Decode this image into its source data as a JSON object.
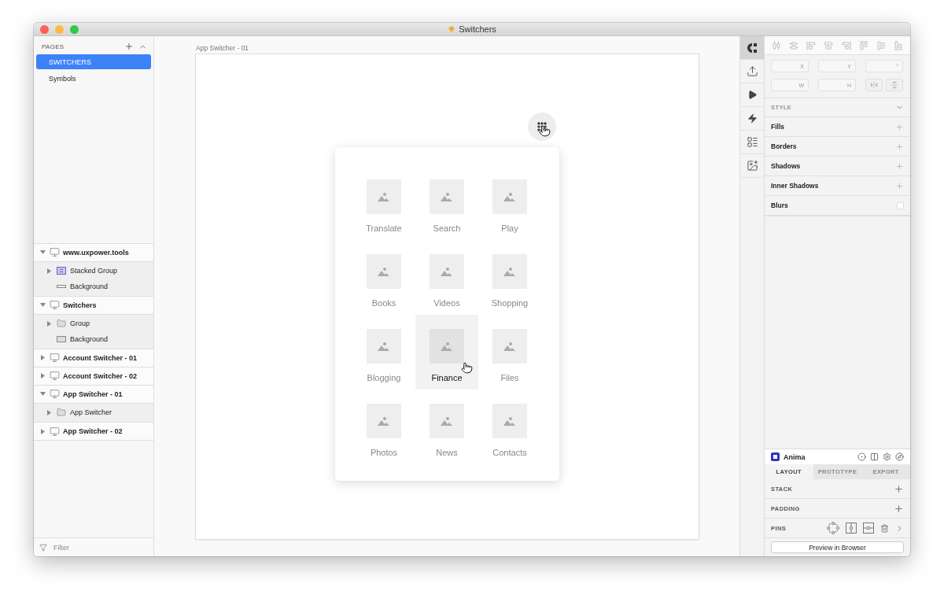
{
  "window": {
    "title": "Switchers"
  },
  "pages": {
    "header": "PAGES",
    "items": [
      {
        "label": "SWITCHERS",
        "selected": true
      },
      {
        "label": "Symbols",
        "selected": false
      }
    ]
  },
  "layers": [
    {
      "name": "www.uxpower.tools",
      "expanded": true,
      "children": [
        {
          "name": "Stacked Group",
          "kind": "stack",
          "expanded": false
        },
        {
          "name": "Background",
          "kind": "line"
        }
      ]
    },
    {
      "name": "Switchers",
      "expanded": true,
      "children": [
        {
          "name": "Group",
          "kind": "group",
          "expanded": false
        },
        {
          "name": "Background",
          "kind": "rectangle"
        }
      ]
    },
    {
      "name": "Account Switcher - 01",
      "expanded": false
    },
    {
      "name": "Account Switcher - 02",
      "expanded": false
    },
    {
      "name": "App Switcher - 01",
      "expanded": true,
      "children": [
        {
          "name": "App Switcher",
          "kind": "group",
          "expanded": false
        }
      ]
    },
    {
      "name": "App Switcher - 02",
      "expanded": false
    }
  ],
  "filter": {
    "placeholder": "Filter"
  },
  "canvas": {
    "artboard_title": "App Switcher - 01",
    "apps": [
      {
        "label": "Translate",
        "selected": false
      },
      {
        "label": "Search",
        "selected": false
      },
      {
        "label": "Play",
        "selected": false
      },
      {
        "label": "Books",
        "selected": false
      },
      {
        "label": "Videos",
        "selected": false
      },
      {
        "label": "Shopping",
        "selected": false
      },
      {
        "label": "Blogging",
        "selected": false
      },
      {
        "label": "Finance",
        "selected": true
      },
      {
        "label": "Files",
        "selected": false
      },
      {
        "label": "Photos",
        "selected": false
      },
      {
        "label": "News",
        "selected": false
      },
      {
        "label": "Contacts",
        "selected": false
      }
    ]
  },
  "inspector_tabs": [
    {
      "kind": "craft",
      "selected": true
    },
    {
      "kind": "export",
      "selected": false
    },
    {
      "kind": "preview",
      "selected": false
    },
    {
      "kind": "prototype",
      "selected": false
    },
    {
      "kind": "layout",
      "selected": false
    },
    {
      "kind": "image",
      "selected": false
    }
  ],
  "fields": [
    {
      "label": "X"
    },
    {
      "label": "Y"
    },
    {
      "label": "°"
    },
    {
      "label": "W"
    },
    {
      "label": "H"
    }
  ],
  "style": {
    "header": "STYLE",
    "sections": [
      {
        "label": "Fills",
        "kind": "add"
      },
      {
        "label": "Borders",
        "kind": "add"
      },
      {
        "label": "Shadows",
        "kind": "add"
      },
      {
        "label": "Inner Shadows",
        "kind": "add"
      },
      {
        "label": "Blurs",
        "kind": "toggle",
        "checked": false
      }
    ]
  },
  "anima": {
    "title": "Anima",
    "tabs": [
      {
        "label": "LAYOUT",
        "selected": true
      },
      {
        "label": "PROTOTYPE",
        "selected": false
      },
      {
        "label": "EXPORT",
        "selected": false
      }
    ],
    "sections": [
      {
        "label": "STACK",
        "kind": "add"
      },
      {
        "label": "PADDING",
        "kind": "add"
      },
      {
        "label": "PINS",
        "kind": "pins"
      }
    ],
    "button": "Preview in Browser"
  }
}
